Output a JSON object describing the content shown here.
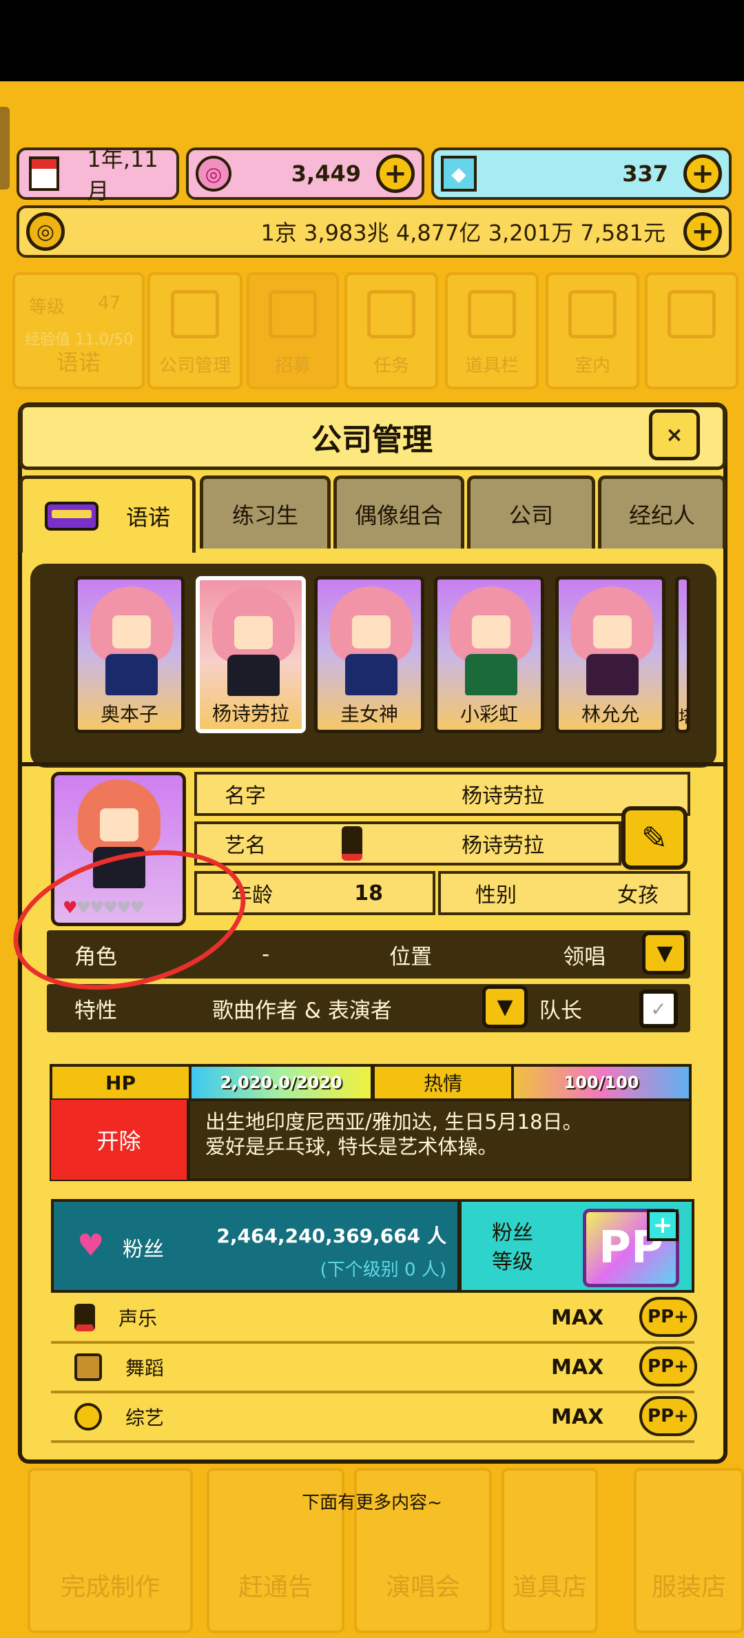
{
  "resources": {
    "date": "1年,11月",
    "gems": "3,449",
    "diamonds": "337",
    "money": "1京 3,983兆 4,877亿 3,201万 7,581元",
    "plus": "+"
  },
  "background_menu": {
    "level_label": "等级",
    "level_value": "47",
    "exp_label": "经验值 11.0/50",
    "company_name": "语诺",
    "items": [
      "公司管理",
      "招募",
      "任务",
      "道具栏",
      "室内"
    ]
  },
  "modal": {
    "title": "公司管理",
    "close": "×",
    "tabs": [
      "语诺",
      "练习生",
      "偶像组合",
      "公司",
      "经纪人"
    ]
  },
  "roster": [
    "奥本子",
    "杨诗劳拉",
    "圭女神",
    "小彩虹",
    "林允允",
    "塔"
  ],
  "profile": {
    "name_label": "名字",
    "name_value": "杨诗劳拉",
    "stage_label": "艺名",
    "stage_value": "杨诗劳拉",
    "age_label": "年龄",
    "age_value": "18",
    "gender_label": "性别",
    "gender_value": "女孩",
    "role_label": "角色",
    "role_value": "-",
    "position_label": "位置",
    "position_value": "领唱",
    "trait_label": "特性",
    "trait_value": "歌曲作者 & 表演者",
    "leader_label": "队长",
    "hearts_filled": 1,
    "hearts_total": 5
  },
  "stats": {
    "hp_label": "HP",
    "hp_value": "2,020.0/2020",
    "passion_label": "热情",
    "passion_value": "100/100",
    "fire_label": "开除",
    "bio_line1": "出生地印度尼西亚/雅加达, 生日5月18日。",
    "bio_line2": "爱好是乒乓球, 特长是艺术体操。"
  },
  "fans": {
    "label": "粉丝",
    "count": "2,464,240,369,664 人",
    "next_level": "(下个级别 0 人)",
    "level_label_1": "粉丝",
    "level_label_2": "等级",
    "logo": "PP",
    "logo_plus": "+"
  },
  "skills": [
    {
      "name": "声乐",
      "value": "MAX",
      "btn": "PP+"
    },
    {
      "name": "舞蹈",
      "value": "MAX",
      "btn": "PP+"
    },
    {
      "name": "综艺",
      "value": "MAX",
      "btn": "PP+"
    }
  ],
  "more_text": "下面有更多内容~",
  "bottom_nav": [
    "完成制作",
    "赶通告",
    "演唱会",
    "道具店",
    "服装店"
  ],
  "colors": {
    "background": "#f4b716",
    "panel": "#fbd94c",
    "dark": "#3d2f0d",
    "fire_button": "#f02a22",
    "annotation": "#e8302c"
  }
}
